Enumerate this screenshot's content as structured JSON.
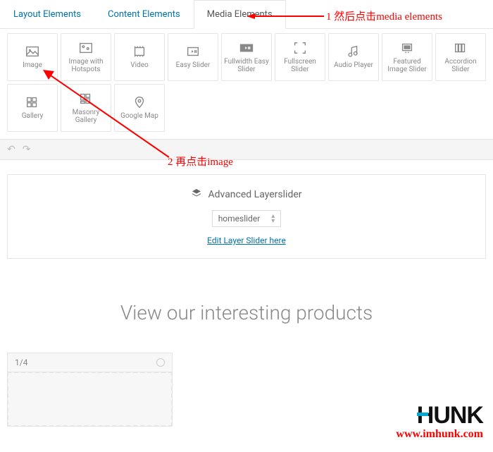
{
  "tabs": {
    "layout": "Layout Elements",
    "content": "Content Elements",
    "media": "Media Elements"
  },
  "elements": {
    "image": "Image",
    "image_hotspots": "Image with Hotspots",
    "video": "Video",
    "easy_slider": "Easy Slider",
    "fullwidth_easy_slider": "Fullwidth Easy Slider",
    "fullscreen_slider": "Fullscreen Slider",
    "audio_player": "Audio Player",
    "featured_image_slider": "Featured Image Slider",
    "accordion_slider": "Accordion Slider",
    "gallery": "Gallery",
    "masonry_gallery": "Masonry Gallery",
    "google_map": "Google Map"
  },
  "layerslider": {
    "title": "Advanced Layerslider",
    "selected": "homeslider",
    "edit_link": "Edit Layer Slider here"
  },
  "heading": "View our interesting products",
  "column": {
    "label": "1/4"
  },
  "annotations": {
    "a1": "1  然后点击media elements",
    "a2": "2  再点击image"
  },
  "logo": {
    "brand": "HUNK",
    "url": "www.imhunk.com"
  }
}
